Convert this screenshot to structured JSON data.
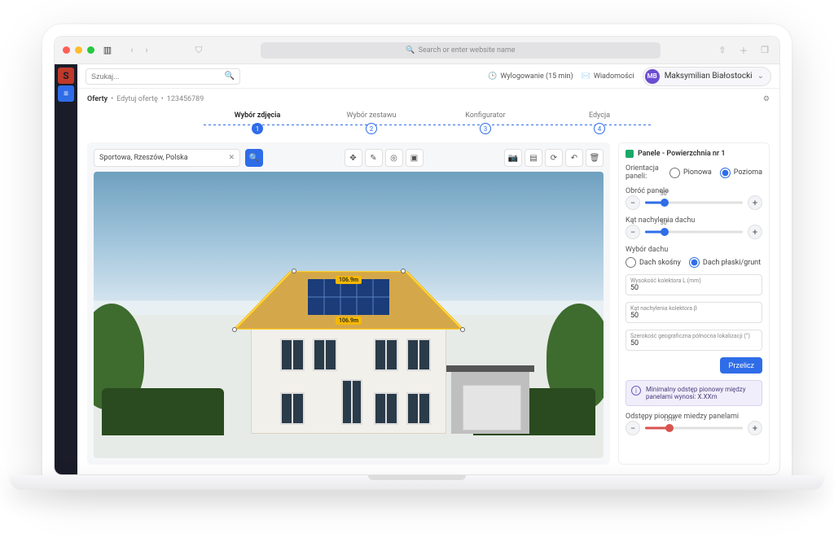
{
  "browser": {
    "placeholder": "Search or enter website name"
  },
  "search": {
    "placeholder": "Szukaj..."
  },
  "topbar": {
    "logout": "Wylogowanie (15 min)",
    "messages": "Wiadomości",
    "user": {
      "initials": "MB",
      "name": "Maksymilian Białostocki"
    }
  },
  "breadcrumb": {
    "root": "Oferty",
    "edit": "Edytuj ofertę",
    "id": "123456789"
  },
  "steps": [
    "Wybór zdjęcia",
    "Wybór zestawu",
    "Konfigurator",
    "Edycja"
  ],
  "canvas": {
    "address": "Sportowa, Rzeszów, Polska",
    "measure_top": "106.9m",
    "measure_bottom": "106.9m"
  },
  "panel": {
    "title": "Panele - Powierzchnia nr 1",
    "orientation": {
      "label": "Orientacja paneli:",
      "opt_v": "Pionowa",
      "opt_h": "Pozioma",
      "selected": "h"
    },
    "rotate": {
      "label": "Obróć panele",
      "value": "30°",
      "percent": 20
    },
    "angle": {
      "label": "Kąt nachylenia dachu",
      "value": "30°",
      "percent": 20
    },
    "roof": {
      "label": "Wybór dachu",
      "opt_slope": "Dach skośny",
      "opt_flat": "Dach płaski/grunt",
      "selected": "flat"
    },
    "fields": {
      "height": {
        "label": "Wysokość kolektora L (mm)",
        "value": "50"
      },
      "collector_angle": {
        "label": "Kąt nachylenia kolektora β",
        "value": "50"
      },
      "latitude": {
        "label": "Szerokość geograficzna północna lokalizacji (°)",
        "value": "50"
      }
    },
    "calc": "Przelicz",
    "info": "Minimalny odstęp pionowy między panelami wynosi: X.XXm",
    "spacing": {
      "label": "Odstępy pionowe miedzy panelami",
      "value": "15 m",
      "percent": 25
    }
  }
}
